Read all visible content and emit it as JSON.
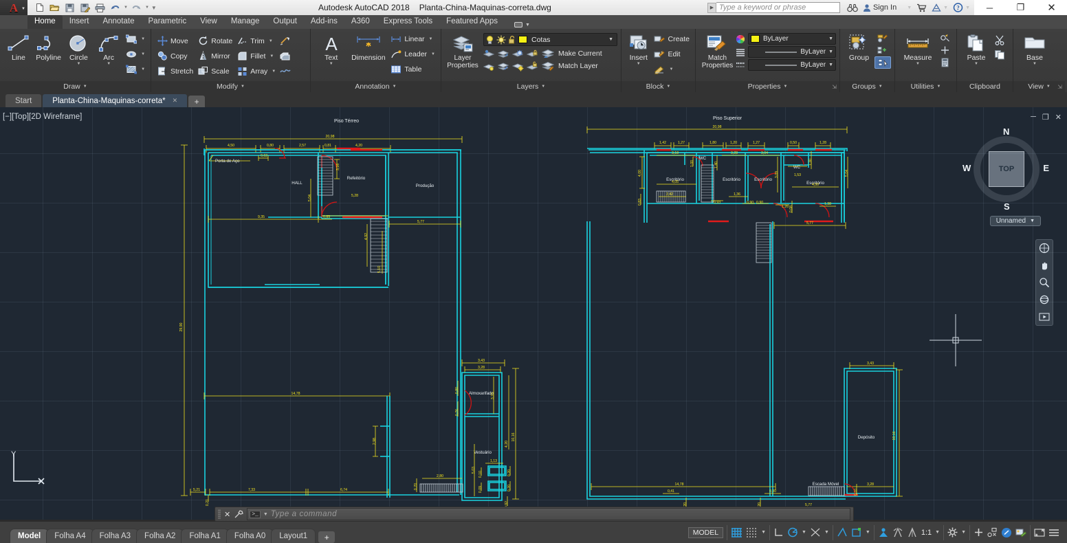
{
  "titlebar": {
    "app_icon": "autocad-a-logo",
    "quick_access": [
      {
        "name": "new-file-icon",
        "glyph": "὜B"
      },
      {
        "name": "open-file-icon",
        "glyph": "open"
      },
      {
        "name": "save-icon",
        "glyph": "save"
      },
      {
        "name": "save-as-icon",
        "glyph": "saveas"
      },
      {
        "name": "plot-icon",
        "glyph": "print"
      },
      {
        "name": "undo-icon",
        "glyph": "undo"
      },
      {
        "name": "redo-icon",
        "glyph": "redo"
      },
      {
        "name": "customize-qat-icon",
        "glyph": "chev"
      }
    ],
    "app_name": "Autodesk AutoCAD 2018",
    "document_name": "Planta-China-Maquinas-correta.dwg",
    "search_placeholder": "Type a keyword or phrase",
    "search_value": "",
    "sign_in_label": "Sign In",
    "window_buttons": [
      "minimize",
      "restore",
      "close"
    ]
  },
  "ribbon_tabs": [
    {
      "label": "Home",
      "active": true
    },
    {
      "label": "Insert",
      "active": false
    },
    {
      "label": "Annotate",
      "active": false
    },
    {
      "label": "Parametric",
      "active": false
    },
    {
      "label": "View",
      "active": false
    },
    {
      "label": "Manage",
      "active": false
    },
    {
      "label": "Output",
      "active": false
    },
    {
      "label": "Add-ins",
      "active": false
    },
    {
      "label": "A360",
      "active": false
    },
    {
      "label": "Express Tools",
      "active": false
    },
    {
      "label": "Featured Apps",
      "active": false
    }
  ],
  "panels": {
    "draw": {
      "title": "Draw",
      "big": [
        {
          "label": "Line",
          "icon": "line-icon",
          "caret": false
        },
        {
          "label": "Polyline",
          "icon": "polyline-icon",
          "caret": false
        },
        {
          "label": "Circle",
          "icon": "circle-icon",
          "caret": true
        },
        {
          "label": "Arc",
          "icon": "arc-icon",
          "caret": true
        }
      ],
      "small": [
        {
          "icon": "rectangle-icon",
          "caret": true
        },
        {
          "icon": "ellipse-icon",
          "caret": true
        },
        {
          "icon": "hatch-icon",
          "caret": true
        }
      ]
    },
    "modify": {
      "title": "Modify",
      "items": [
        {
          "label": "Move",
          "icon": "move-icon",
          "caret": false
        },
        {
          "label": "Rotate",
          "icon": "rotate-icon",
          "caret": false
        },
        {
          "label": "Trim",
          "icon": "trim-icon",
          "caret": true
        },
        {
          "label": "Copy",
          "icon": "copy-icon",
          "caret": false
        },
        {
          "label": "Mirror",
          "icon": "mirror-icon",
          "caret": false
        },
        {
          "label": "Fillet",
          "icon": "fillet-icon",
          "caret": true
        },
        {
          "label": "Stretch",
          "icon": "stretch-icon",
          "caret": false
        },
        {
          "label": "Scale",
          "icon": "scale-icon",
          "caret": false
        },
        {
          "label": "Array",
          "icon": "array-icon",
          "caret": true
        }
      ],
      "extra": [
        {
          "icon": "explode-icon"
        },
        {
          "icon": "offset-icon"
        },
        {
          "icon": "break-icon"
        }
      ]
    },
    "annotation": {
      "title": "Annotation",
      "big": [
        {
          "label": "Text",
          "icon": "text-icon",
          "caret": true
        },
        {
          "label": "Dimension",
          "icon": "dimension-icon",
          "caret": false
        }
      ],
      "small": [
        {
          "label": "Linear",
          "icon": "linear-dim-icon",
          "caret": true
        },
        {
          "label": "Leader",
          "icon": "leader-icon",
          "caret": true
        },
        {
          "label": "Table",
          "icon": "table-icon",
          "caret": false
        }
      ]
    },
    "layers": {
      "title": "Layers",
      "big": {
        "label": "Layer\nProperties",
        "icon": "layer-properties-icon"
      },
      "current_layer": "Cotas",
      "layer_color": "#f5f114",
      "toggles": [
        "lightbulb-icon",
        "sun-icon",
        "unlock-icon"
      ],
      "row1": [
        "layer-isolate-icon",
        "layer-freeze-icon",
        "layer-off-icon",
        "layer-lock-icon"
      ],
      "row2": [
        "layer-unisolate-icon",
        "layer-thaw-icon",
        "layer-on-icon",
        "layer-unlock-icon"
      ],
      "make_current": "Make Current",
      "match_layer": "Match Layer"
    },
    "block": {
      "title": "Block",
      "big": {
        "label": "Insert",
        "icon": "insert-block-icon",
        "caret": true
      },
      "items": [
        {
          "label": "Create",
          "icon": "create-block-icon"
        },
        {
          "label": "Edit",
          "icon": "edit-block-icon"
        },
        {
          "label": "",
          "icon": "edit-attribute-icon",
          "caret": true
        }
      ]
    },
    "properties": {
      "title": "Properties",
      "big": {
        "label": "Match\nProperties",
        "icon": "match-properties-icon"
      },
      "color_value": "ByLayer",
      "color_swatch": "#f5f114",
      "linetype_value": "ByLayer",
      "lineweight_value": "ByLayer",
      "dialog_launcher": true
    },
    "groups": {
      "title": "Groups",
      "big": {
        "label": "Group",
        "icon": "group-icon"
      },
      "items": [
        "edit-group-icon",
        "add-to-group-icon",
        "group-selection-on-icon"
      ]
    },
    "utilities": {
      "title": "Utilities",
      "big": {
        "label": "Measure",
        "icon": "measure-icon",
        "caret": true
      },
      "items": [
        "quick-select-icon",
        "point-id-icon",
        "calculator-icon"
      ]
    },
    "clipboard": {
      "title": "Clipboard",
      "big": {
        "label": "Paste",
        "icon": "paste-icon",
        "caret": true
      },
      "items": [
        "cut-icon",
        "copy-clip-icon"
      ]
    },
    "view": {
      "title": "View",
      "big": {
        "label": "Base",
        "icon": "base-view-icon",
        "caret": true
      },
      "dialog_launcher": true
    }
  },
  "file_tabs": [
    {
      "label": "Start",
      "active": false,
      "closable": false
    },
    {
      "label": "Planta-China-Maquinas-correta*",
      "active": true,
      "closable": true
    }
  ],
  "viewport": {
    "label": "[−][Top][2D Wireframe]",
    "controls": [
      "minimize-viewport",
      "restore-viewport",
      "close-viewport"
    ],
    "viewcube": {
      "top": "TOP",
      "n": "N",
      "s": "S",
      "e": "E",
      "w": "W"
    },
    "ucs_name": "Unnamed",
    "nav_icons": [
      "steering-wheel-icon",
      "pan-icon",
      "zoom-extents-icon",
      "orbit-icon",
      "showmotion-icon"
    ],
    "ucs_axis": {
      "y": "Y",
      "x": ""
    }
  },
  "drawing": {
    "plan_left_title": "Piso Térreo",
    "plan_right_title": "Piso Superior",
    "left_rooms": [
      "HALL",
      "Refeitório",
      "Produção",
      "Almoxarifado",
      "Vestuário"
    ],
    "left_leader": "Porta de Aço",
    "left_dims": [
      "20,98",
      "4,50",
      "0,80",
      "2,57",
      "0,81",
      "4,20",
      "0,62",
      "3,16",
      "5,28",
      "5,04",
      "9,35",
      "0,85",
      "5,77",
      "4,92",
      "5,10",
      "29,90",
      "14,78",
      "2,98",
      "5,21",
      "7,33",
      "6,74",
      "0,21",
      "3,43",
      "3,28",
      "3,23",
      "0,80",
      "0,70",
      "0,76",
      "4,20",
      "10,16",
      "5,03",
      "2,80",
      "1,13",
      "0,10",
      "0,05",
      "0,20",
      "0,09",
      "0,92"
    ],
    "right_rooms": [
      "Escritório",
      "WC",
      "Escritório",
      "Escritório",
      "WC",
      "Escritório",
      "Depósito"
    ],
    "right_leader": "Escada Móvel",
    "right_dims": [
      "20,98",
      "1,42",
      "1,27",
      "1,80",
      "1,20",
      "1,27",
      "0,50",
      "1,28",
      "3,18",
      "1,00",
      "1,40",
      "3,28",
      "3,04",
      "1,53",
      "1,30",
      "4,00",
      "4,05",
      "3,09",
      "4,50",
      "2,42",
      "1,36",
      "0,93",
      "0,90",
      "0,90",
      "1,26",
      "0,08",
      "5,04",
      "1,38",
      "5,77",
      "14,78",
      "0,41",
      "0,30",
      "3,28",
      "0,10",
      "10,16",
      "0,83"
    ]
  },
  "command_line": {
    "placeholder": "Type a command",
    "value": "",
    "icons": [
      "close-command-icon",
      "customize-command-icon",
      "prompt-icon"
    ]
  },
  "layout_tabs": [
    {
      "label": "Model",
      "active": true
    },
    {
      "label": "Folha A4",
      "active": false
    },
    {
      "label": "Folha A3",
      "active": false
    },
    {
      "label": "Folha A2",
      "active": false
    },
    {
      "label": "Folha A1",
      "active": false
    },
    {
      "label": "Folha A0",
      "active": false
    },
    {
      "label": "Layout1",
      "active": false
    }
  ],
  "status_bar": {
    "space_toggle": "MODEL",
    "annotation_scale": "1:1",
    "icons": [
      {
        "name": "grid-display-icon",
        "on": true
      },
      {
        "name": "snap-mode-icon",
        "on": false
      },
      {
        "name": "ortho-mode-icon",
        "on": false
      },
      {
        "name": "polar-tracking-icon",
        "on": true
      },
      {
        "name": "object-snap-tracking-icon",
        "on": false
      },
      {
        "name": "object-snap-icon",
        "on": true
      },
      {
        "name": "dynamic-ucs-icon",
        "on": true
      },
      {
        "name": "show-annotation-objects-icon",
        "on": true
      },
      {
        "name": "add-scales-icon",
        "on": false
      },
      {
        "name": "annotation-visibility-icon",
        "on": false
      },
      {
        "name": "workspace-switching-icon",
        "on": false
      },
      {
        "name": "annotation-monitor-icon",
        "on": false
      },
      {
        "name": "isolate-objects-icon",
        "on": false
      },
      {
        "name": "hardware-acceleration-icon",
        "on": true
      },
      {
        "name": "clean-screen-icon",
        "on": false
      },
      {
        "name": "customization-icon",
        "on": false
      }
    ]
  }
}
